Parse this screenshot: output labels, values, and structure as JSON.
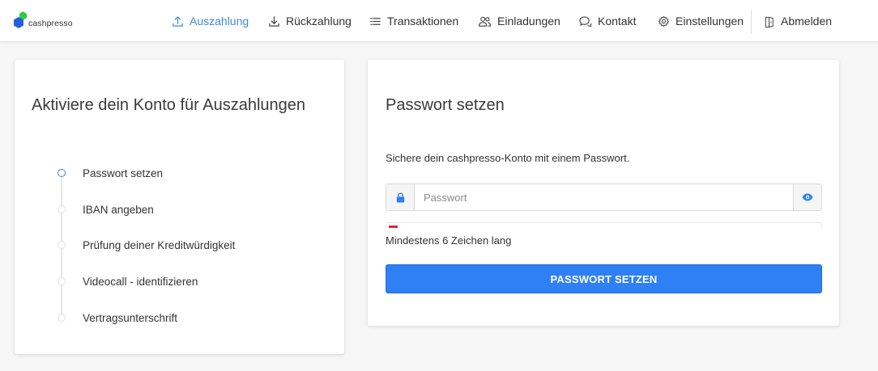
{
  "brand": {
    "logo_text": "cashpresso",
    "colors": {
      "green": "#2ecc40",
      "blue": "#1f5fe0"
    }
  },
  "nav": {
    "items": [
      {
        "label": "Auszahlung",
        "icon": "upload-icon",
        "active": true
      },
      {
        "label": "Rückzahlung",
        "icon": "download-icon",
        "active": false
      },
      {
        "label": "Transaktionen",
        "icon": "list-icon",
        "active": false
      },
      {
        "label": "Einladungen",
        "icon": "users-icon",
        "active": false
      },
      {
        "label": "Kontakt",
        "icon": "chat-icon",
        "active": false
      },
      {
        "label": "Einstellungen",
        "icon": "gear-icon",
        "active": false
      },
      {
        "label": "Abmelden",
        "icon": "door-icon",
        "active": false
      }
    ],
    "active_color": "#3d8bd9"
  },
  "activation": {
    "title": "Aktiviere dein Konto für Auszahlungen",
    "steps": [
      {
        "label": "Passwort setzen",
        "current": true
      },
      {
        "label": "IBAN angeben",
        "current": false
      },
      {
        "label": "Prüfung deiner Kreditwürdigkeit",
        "current": false
      },
      {
        "label": "Videocall - identifizieren",
        "current": false
      },
      {
        "label": "Vertragsunterschrift",
        "current": false
      }
    ]
  },
  "password_form": {
    "title": "Passwort setzen",
    "description": "Sichere dein cashpresso-Konto mit einem Passwort.",
    "input_value": "",
    "input_placeholder": "Passwort",
    "prefix_icon": "lock-icon",
    "suffix_icon": "eye-icon",
    "strength_level": 0.02,
    "strength_color": "#e5243f",
    "hint": "Mindestens 6 Zeichen lang",
    "submit_label": "PASSWORT SETZEN",
    "submit_color": "#2f7ff5"
  }
}
